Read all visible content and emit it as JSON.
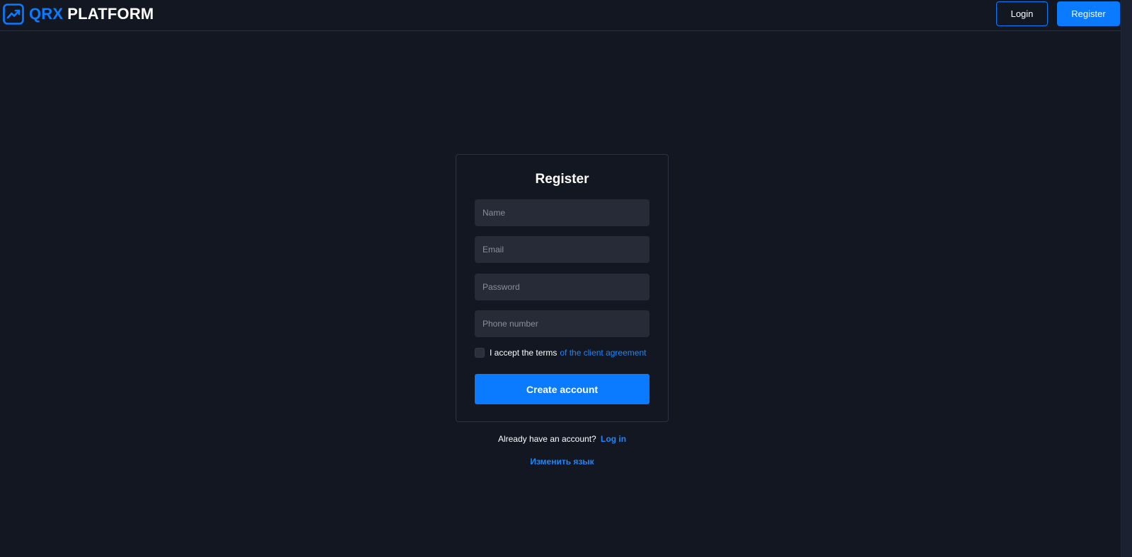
{
  "header": {
    "logo": {
      "icon": "trending-up-icon",
      "accent_text": "QRX",
      "main_text": "PLATFORM"
    },
    "login_label": "Login",
    "register_label": "Register"
  },
  "form": {
    "title": "Register",
    "name_placeholder": "Name",
    "email_placeholder": "Email",
    "password_placeholder": "Password",
    "phone_placeholder": "Phone number",
    "terms_text": "I accept the terms",
    "terms_link": "of the client agreement",
    "terms_checked": false,
    "submit_label": "Create account"
  },
  "footer": {
    "already_text": "Already have an account?",
    "login_link": "Log in",
    "change_language": "Изменить язык"
  },
  "colors": {
    "background": "#121722",
    "accent": "#0a7aff",
    "input_bg": "#262b37",
    "border": "#2c3242"
  }
}
